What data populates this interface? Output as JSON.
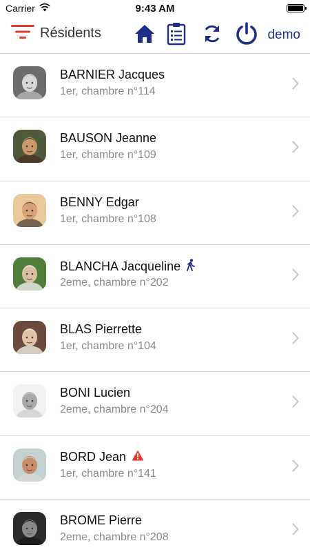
{
  "status_bar": {
    "carrier": "Carrier",
    "time": "9:43 AM",
    "battery_level": 1.0
  },
  "nav": {
    "title": "Résidents",
    "user": "demo",
    "icons": [
      "filter-icon",
      "home-icon",
      "clipboard-icon",
      "sync-icon",
      "power-icon"
    ],
    "accent_color": "#1e2d86",
    "filter_color": "#e53b2c"
  },
  "residents": [
    {
      "name": "BARNIER Jacques",
      "location": "1er, chambre n°114",
      "badge": ""
    },
    {
      "name": "BAUSON Jeanne",
      "location": "1er, chambre n°109",
      "badge": ""
    },
    {
      "name": "BENNY Edgar",
      "location": "1er, chambre n°108",
      "badge": ""
    },
    {
      "name": "BLANCHA Jacqueline",
      "location": "2eme, chambre n°202",
      "badge": "walking-person-icon"
    },
    {
      "name": "BLAS Pierrette",
      "location": "1er, chambre n°104",
      "badge": ""
    },
    {
      "name": "BONI Lucien",
      "location": "2eme, chambre n°204",
      "badge": ""
    },
    {
      "name": "BORD Jean",
      "location": "1er, chambre n°141",
      "badge": "warning-icon"
    },
    {
      "name": "BROME Pierre",
      "location": "2eme, chambre n°208",
      "badge": ""
    }
  ]
}
